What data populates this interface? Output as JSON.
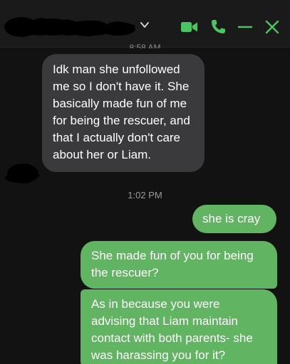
{
  "header": {
    "contact_name": "redacted"
  },
  "messages": {
    "timestamp_top": "8:58 AM",
    "incoming_1": "Idk man she unfollowed me so I don't have it. She basically made fun of me for being the rescuer, and that I actually don't care about her or Liam.",
    "timestamp_mid": "1:02 PM",
    "outgoing_1": "she is cray",
    "outgoing_2": "She made fun of you for being the rescuer?",
    "outgoing_3": "As in because you were advising that Liam maintain contact with both parents- she was harassing you for it?"
  },
  "colors": {
    "accent": "#4bc463",
    "outgoing_bubble": "#61b461",
    "incoming_bubble": "#3a3a3c"
  },
  "icons": {
    "video": "video-camera-icon",
    "phone": "phone-icon",
    "minimize": "minus-icon",
    "close": "close-icon",
    "chevron": "chevron-down-icon"
  }
}
